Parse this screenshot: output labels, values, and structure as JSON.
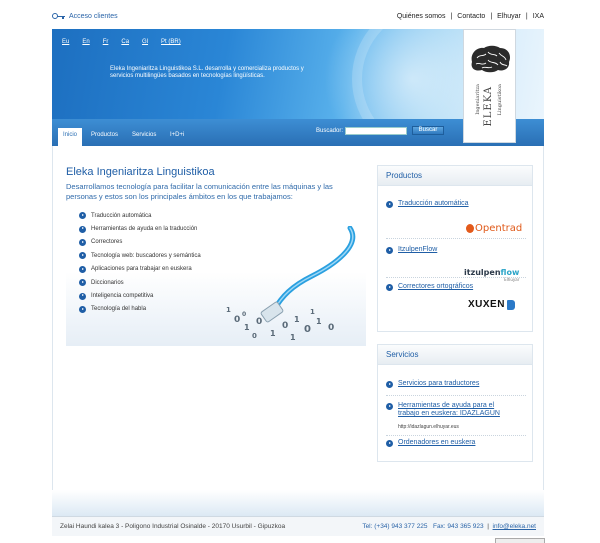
{
  "topbar": {
    "access_label": "Acceso clientes",
    "links": [
      "Quiénes somos",
      "Contacto",
      "Elhuyar",
      "IXA"
    ],
    "separator": "|"
  },
  "header": {
    "languages": [
      "Eu",
      "En",
      "Fr",
      "Ca",
      "Gl",
      "Pt (BR)"
    ],
    "tagline": "Eleka Ingeniaritza Linguistikoa S.L. desarrolla y comercializa productos y servicios multilingües basados en tecnologías lingüísticas."
  },
  "logo": {
    "name": "ELEKA",
    "line_top": "Ingeniaritza",
    "line_bottom": "Linguistikoa"
  },
  "nav": {
    "tabs": [
      "Inicio",
      "Productos",
      "Servicios",
      "I+D+i"
    ],
    "active_tab": "Inicio",
    "search_label": "Buscador:",
    "search_value": "",
    "search_button": "Buscar"
  },
  "main": {
    "title": "Eleka Ingeniaritza Linguistikoa",
    "intro": "Desarrollamos tecnología para facilitar la comunicación entre las máquinas y las personas y estos son los principales ámbitos en los que trabajamos:",
    "features": [
      "Traducción automática",
      "Herramientas de ayuda en la traducción",
      "Correctores",
      "Tecnología web: buscadores y semántica",
      "Aplicaciones para trabajar en euskera",
      "Diccionarios",
      "Inteligencia competitiva",
      "Tecnología del habla"
    ]
  },
  "products": {
    "title": "Productos",
    "items": [
      "Traducción automática",
      "ItzulpenFlow",
      "Correctores ortográficos"
    ],
    "logos": {
      "opentrad": "Opentrad",
      "itzulpen_main": "itzulpen",
      "itzulpen_flow": "flow",
      "itzulpen_by": "Elhuyar",
      "xuxen": "XUXEN"
    }
  },
  "services": {
    "title": "Servicios",
    "items": [
      "Servicios para traductores",
      "Herramientas de ayuda para el trabajo en euskera: IDAZLAGUN",
      "Ordenadores en euskera"
    ],
    "url": "http://idazlagun.elhuyar.eus"
  },
  "footer": {
    "address": "Zelai Haundi kalea 3 - Poligono Industrial Osinalde - 20170 Usurbil - Gipuzkoa",
    "phone": "Tel: (+34) 943 377 225",
    "fax": "Fax: 943 365 923",
    "separator": "|",
    "email": "info@eleka.net"
  },
  "colors": {
    "brand_blue": "#1f5ea6",
    "nav_blue": "#2a6fb4",
    "cable_blue": "#2aa0e0",
    "opentrad_orange": "#e35a1b"
  }
}
